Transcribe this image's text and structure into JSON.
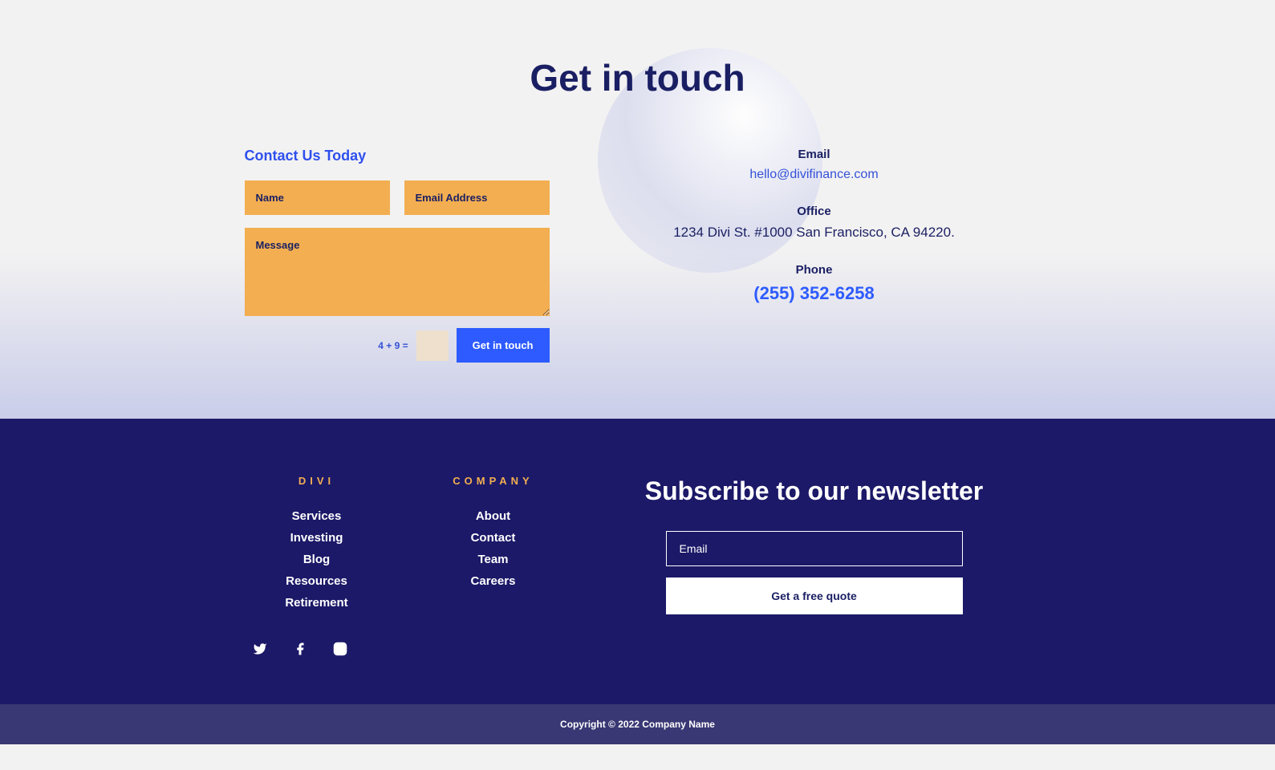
{
  "hero": {
    "title": "Get in touch"
  },
  "contact_form": {
    "heading": "Contact Us Today",
    "name_placeholder": "Name",
    "email_placeholder": "Email Address",
    "message_placeholder": "Message",
    "captcha_label": "4 + 9 =",
    "submit_label": "Get in touch"
  },
  "contact_info": {
    "email_label": "Email",
    "email_value": "hello@divifinance.com",
    "office_label": "Office",
    "office_value": "1234 Divi St. #1000 San Francisco, CA 94220.",
    "phone_label": "Phone",
    "phone_value": "(255) 352-6258"
  },
  "footer": {
    "col1": {
      "heading": "DIVI",
      "links": [
        "Services",
        "Investing",
        "Blog",
        "Resources",
        "Retirement"
      ]
    },
    "col2": {
      "heading": "COMPANY",
      "links": [
        "About",
        "Contact",
        "Team",
        "Careers"
      ]
    },
    "newsletter": {
      "heading": "Subscribe to our newsletter",
      "email_placeholder": "Email",
      "button_label": "Get a free quote"
    },
    "copyright": "Copyright © 2022 Company Name"
  }
}
